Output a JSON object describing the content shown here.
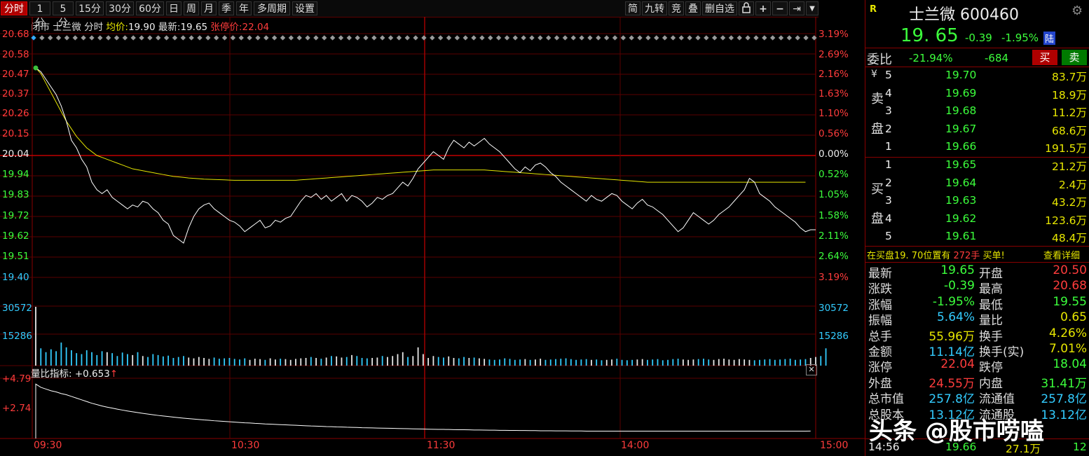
{
  "toolbar": {
    "tabs": [
      "分时",
      "1分",
      "5分",
      "15分",
      "30分",
      "60分",
      "日",
      "周",
      "月",
      "季",
      "年",
      "多周期",
      "设置"
    ],
    "right_tools": [
      "简",
      "九转",
      "竞",
      "叠",
      "删自选"
    ],
    "lock_icon": "lock-icon",
    "plus_icon": "plus-icon",
    "minus_icon": "minus-icon",
    "arrow_icon": "arrow-right-end-icon",
    "dropdown_icon": "chevron-down-icon"
  },
  "info": {
    "status": "闭市",
    "name": "士兰微",
    "mode": "分时",
    "avg_label": "均价:",
    "avg_value": "19.90",
    "latest_label": "最新:",
    "latest_value": "19.65",
    "limit_label": "张停价:",
    "limit_value": "22.04"
  },
  "price_axis": {
    "left": [
      "20.68",
      "20.58",
      "20.47",
      "20.37",
      "20.26",
      "20.15",
      "20.04",
      "19.94",
      "19.83",
      "19.72",
      "19.62",
      "19.51",
      "19.40"
    ],
    "right": [
      "3.19%",
      "2.69%",
      "2.16%",
      "1.63%",
      "1.10%",
      "0.56%",
      "0.00%",
      "0.52%",
      "1.05%",
      "1.58%",
      "2.11%",
      "2.64%",
      "3.19%"
    ]
  },
  "volume_axis": {
    "left": [
      "30572",
      "15286"
    ],
    "right": [
      "30572",
      "15286"
    ]
  },
  "indicator": {
    "label": "量比指标:",
    "value": "+0.653",
    "arrow": "↑",
    "axis": [
      "+4.79",
      "+2.74"
    ],
    "close_icon": "close-icon"
  },
  "time_labels": [
    "09:30",
    "10:30",
    "11:30",
    "14:00",
    "15:00"
  ],
  "panel": {
    "r_badge": "R",
    "title": "士兰微 600460",
    "settings_icon": "gear-icon",
    "price": "19. 65",
    "change": "-0.39",
    "change_pct": "-1.95%",
    "market": "陆",
    "weibi_label": "委比",
    "weibi_pct": "-21.94%",
    "weibi_diff": "-684",
    "buy_btn": "买",
    "sell_btn": "卖",
    "sell_side_chars": [
      "¥",
      "卖",
      "盘"
    ],
    "buy_side_chars": [
      "买",
      "盘"
    ],
    "asks": [
      {
        "level": "5",
        "price": "19.70",
        "vol": "83.7万"
      },
      {
        "level": "4",
        "price": "19.69",
        "vol": "18.9万"
      },
      {
        "level": "3",
        "price": "19.68",
        "vol": "11.2万"
      },
      {
        "level": "2",
        "price": "19.67",
        "vol": "68.6万"
      },
      {
        "level": "1",
        "price": "19.66",
        "vol": "191.5万"
      }
    ],
    "bids": [
      {
        "level": "1",
        "price": "19.65",
        "vol": "21.2万"
      },
      {
        "level": "2",
        "price": "19.64",
        "vol": "2.4万"
      },
      {
        "level": "3",
        "price": "19.63",
        "vol": "43.2万"
      },
      {
        "level": "4",
        "price": "19.62",
        "vol": "123.6万"
      },
      {
        "level": "5",
        "price": "19.61",
        "vol": "48.4万"
      }
    ],
    "notice_prefix": "在买盘19. 70位置有",
    "notice_qty": "272手",
    "notice_action": "买单!",
    "notice_link": "查看详细",
    "stats": [
      {
        "l1": "最新",
        "v1": "19.65",
        "l2": "开盘",
        "v2": "20.50"
      },
      {
        "l1": "涨跌",
        "v1": "-0.39",
        "l2": "最高",
        "v2": "20.68"
      },
      {
        "l1": "涨幅",
        "v1": "-1.95%",
        "l2": "最低",
        "v2": "19.55"
      },
      {
        "l1": "振幅",
        "v1": "5.64%",
        "l2": "量比",
        "v2": "0.65"
      },
      {
        "l1": "总手",
        "v1": "55.96万",
        "l2": "换手",
        "v2": "4.26%"
      },
      {
        "l1": "金额",
        "v1": "11.14亿",
        "l2": "换手(实)",
        "v2": "7.01%"
      },
      {
        "l1": "涨停",
        "v1": "22.04",
        "l2": "跌停",
        "v2": "18.04"
      },
      {
        "l1": "外盘",
        "v1": "24.55万",
        "l2": "内盘",
        "v2": "31.41万"
      },
      {
        "l1": "总市值",
        "v1": "257.8亿",
        "l2": "流通值",
        "v2": "257.8亿"
      },
      {
        "l1": "总股本",
        "v1": "13.12亿",
        "l2": "流通股",
        "v2": "13.12亿"
      }
    ],
    "last_trade": {
      "time": "14:56",
      "price": "19.66",
      "vol": "27.1万",
      "count": "12"
    },
    "watermark": "头条 @股市唠嗑"
  },
  "colors": {
    "up": "#ff3c3c",
    "down": "#3cff3c",
    "avg": "#e6e600",
    "grid": "#6a0000",
    "bg": "#000000"
  },
  "chart_data": {
    "type": "line",
    "prev_close": 20.04,
    "ylim": [
      19.4,
      20.68
    ],
    "price": [
      20.5,
      20.48,
      20.44,
      20.4,
      20.36,
      20.3,
      20.22,
      20.12,
      20.08,
      20.02,
      19.98,
      19.9,
      19.86,
      19.84,
      19.86,
      19.82,
      19.8,
      19.78,
      19.76,
      19.78,
      19.77,
      19.8,
      19.79,
      19.76,
      19.74,
      19.7,
      19.68,
      19.62,
      19.6,
      19.58,
      19.66,
      19.72,
      19.76,
      19.78,
      19.79,
      19.76,
      19.74,
      19.72,
      19.7,
      19.69,
      19.67,
      19.64,
      19.66,
      19.68,
      19.7,
      19.66,
      19.67,
      19.7,
      19.69,
      19.71,
      19.72,
      19.76,
      19.8,
      19.83,
      19.82,
      19.84,
      19.81,
      19.83,
      19.8,
      19.82,
      19.84,
      19.8,
      19.83,
      19.82,
      19.8,
      19.77,
      19.79,
      19.82,
      19.81,
      19.83,
      19.84,
      19.87,
      19.9,
      19.88,
      19.92,
      19.97,
      20.0,
      20.03,
      20.06,
      20.04,
      20.02,
      20.08,
      20.12,
      20.1,
      20.08,
      20.11,
      20.09,
      20.11,
      20.13,
      20.1,
      20.08,
      20.06,
      20.03,
      20.0,
      19.97,
      19.95,
      19.98,
      19.96,
      19.99,
      20.0,
      19.98,
      19.95,
      19.93,
      19.9,
      19.88,
      19.86,
      19.84,
      19.82,
      19.8,
      19.83,
      19.81,
      19.8,
      19.82,
      19.84,
      19.83,
      19.8,
      19.78,
      19.76,
      19.79,
      19.81,
      19.78,
      19.77,
      19.75,
      19.73,
      19.7,
      19.67,
      19.64,
      19.66,
      19.7,
      19.74,
      19.72,
      19.7,
      19.68,
      19.7,
      19.73,
      19.75,
      19.77,
      19.8,
      19.83,
      19.86,
      19.92,
      19.9,
      19.84,
      19.82,
      19.8,
      19.77,
      19.75,
      19.73,
      19.71,
      19.69,
      19.66,
      19.64,
      19.65,
      19.65
    ],
    "avg": [
      20.5,
      20.47,
      20.42,
      20.37,
      20.32,
      20.27,
      20.22,
      20.18,
      20.14,
      20.11,
      20.08,
      20.06,
      20.04,
      20.03,
      20.02,
      20.01,
      20.0,
      19.99,
      19.98,
      19.97,
      19.965,
      19.96,
      19.955,
      19.95,
      19.945,
      19.94,
      19.935,
      19.93,
      19.928,
      19.925,
      19.922,
      19.92,
      19.918,
      19.916,
      19.915,
      19.914,
      19.913,
      19.912,
      19.911,
      19.91,
      19.91,
      19.91,
      19.91,
      19.91,
      19.91,
      19.91,
      19.91,
      19.91,
      19.91,
      19.91,
      19.91,
      19.91,
      19.912,
      19.914,
      19.916,
      19.918,
      19.92,
      19.922,
      19.924,
      19.926,
      19.928,
      19.93,
      19.932,
      19.934,
      19.936,
      19.938,
      19.94,
      19.942,
      19.944,
      19.946,
      19.948,
      19.95,
      19.952,
      19.954,
      19.956,
      19.958,
      19.96,
      19.962,
      19.964,
      19.964,
      19.964,
      19.964,
      19.964,
      19.964,
      19.964,
      19.964,
      19.964,
      19.964,
      19.964,
      19.962,
      19.96,
      19.958,
      19.956,
      19.954,
      19.952,
      19.95,
      19.948,
      19.946,
      19.944,
      19.942,
      19.94,
      19.938,
      19.936,
      19.934,
      19.932,
      19.93,
      19.928,
      19.926,
      19.924,
      19.922,
      19.92,
      19.918,
      19.916,
      19.914,
      19.912,
      19.91,
      19.908,
      19.906,
      19.904,
      19.902,
      19.9,
      19.9,
      19.9,
      19.9,
      19.9,
      19.9,
      19.9,
      19.9,
      19.9,
      19.9,
      19.9,
      19.9,
      19.9,
      19.9,
      19.9,
      19.9,
      19.9,
      19.9,
      19.9,
      19.9,
      19.9,
      19.9,
      19.9,
      19.9,
      19.9,
      19.9,
      19.9,
      19.9,
      19.9,
      19.9,
      19.9,
      19.9
    ],
    "volume": [
      30572,
      9000,
      7000,
      8500,
      7500,
      12000,
      9500,
      8000,
      6500,
      6000,
      8000,
      7000,
      5500,
      7500,
      7000,
      6500,
      5000,
      6800,
      6000,
      5500,
      7000,
      5000,
      4500,
      6000,
      5500,
      4800,
      5200,
      4000,
      4500,
      5000,
      4200,
      3800,
      4500,
      4000,
      3500,
      4200,
      3600,
      3800,
      4000,
      3500,
      3200,
      3800,
      3000,
      3600,
      3400,
      3000,
      3800,
      3200,
      3600,
      3400,
      3000,
      3500,
      3800,
      4000,
      4500,
      4000,
      3600,
      4200,
      5000,
      4800,
      4200,
      4500,
      5500,
      5000,
      4000,
      3800,
      4000,
      4200,
      5000,
      4500,
      5000,
      6000,
      7000,
      4500,
      5000,
      9500,
      6000,
      4000,
      5000,
      4500,
      4200,
      4800,
      4000,
      3800,
      4500,
      4000,
      4200,
      3800,
      3500,
      3200,
      3000,
      3200,
      3800,
      3500,
      3000,
      3200,
      3400,
      3000,
      3200,
      3600,
      3000,
      3200,
      3400,
      3600,
      3800,
      3400,
      3000,
      3200,
      3400,
      3000,
      3200,
      2800,
      3000,
      3200,
      3600,
      3000,
      2800,
      3000,
      3200,
      3400,
      3000,
      3200,
      3400,
      2800,
      3000,
      3400,
      3600,
      3200,
      3000,
      3200,
      3400,
      3600,
      3200,
      3000,
      3400,
      3600,
      3200,
      3000,
      3400,
      3200,
      3000,
      2800,
      3000,
      3200,
      3400,
      3000,
      3200,
      3400,
      3600,
      3000,
      3200,
      3400,
      4000,
      4500,
      5000,
      9000
    ],
    "volume_ylim": [
      0,
      45858
    ],
    "vol_ratio": [
      4.79,
      4.5,
      4.35,
      4.2,
      4.1,
      3.95,
      3.85,
      3.7,
      3.55,
      3.4,
      3.25,
      3.1,
      2.98,
      2.86,
      2.76,
      2.67,
      2.58,
      2.5,
      2.42,
      2.35,
      2.28,
      2.21,
      2.15,
      2.09,
      2.03,
      1.98,
      1.93,
      1.88,
      1.83,
      1.79,
      1.75,
      1.71,
      1.67,
      1.63,
      1.6,
      1.56,
      1.53,
      1.5,
      1.47,
      1.44,
      1.41,
      1.38,
      1.36,
      1.33,
      1.31,
      1.28,
      1.26,
      1.24,
      1.22,
      1.2,
      1.18,
      1.16,
      1.14,
      1.12,
      1.1,
      1.09,
      1.07,
      1.05,
      1.04,
      1.02,
      1.01,
      0.99,
      0.98,
      0.97,
      0.95,
      0.94,
      0.93,
      0.92,
      0.91,
      0.9,
      0.89,
      0.88,
      0.87,
      0.86,
      0.85,
      0.84,
      0.83,
      0.82,
      0.81,
      0.8,
      0.8,
      0.79,
      0.78,
      0.77,
      0.77,
      0.76,
      0.75,
      0.75,
      0.74,
      0.73,
      0.73,
      0.72,
      0.72,
      0.71,
      0.71,
      0.7,
      0.7,
      0.69,
      0.69,
      0.68,
      0.68,
      0.68,
      0.67,
      0.67,
      0.67,
      0.66,
      0.66,
      0.66,
      0.65,
      0.65,
      0.65,
      0.65,
      0.65,
      0.65,
      0.65,
      0.65,
      0.65,
      0.65,
      0.65,
      0.65,
      0.65,
      0.65,
      0.65,
      0.65,
      0.65,
      0.65,
      0.65,
      0.65,
      0.65,
      0.65,
      0.65,
      0.65,
      0.65,
      0.65,
      0.65,
      0.65,
      0.65,
      0.65,
      0.65,
      0.65,
      0.65,
      0.65,
      0.65,
      0.65,
      0.65,
      0.65,
      0.65,
      0.65,
      0.65,
      0.65,
      0.65,
      0.65,
      0.653
    ],
    "vol_ratio_ylim": [
      0,
      5.3
    ]
  }
}
